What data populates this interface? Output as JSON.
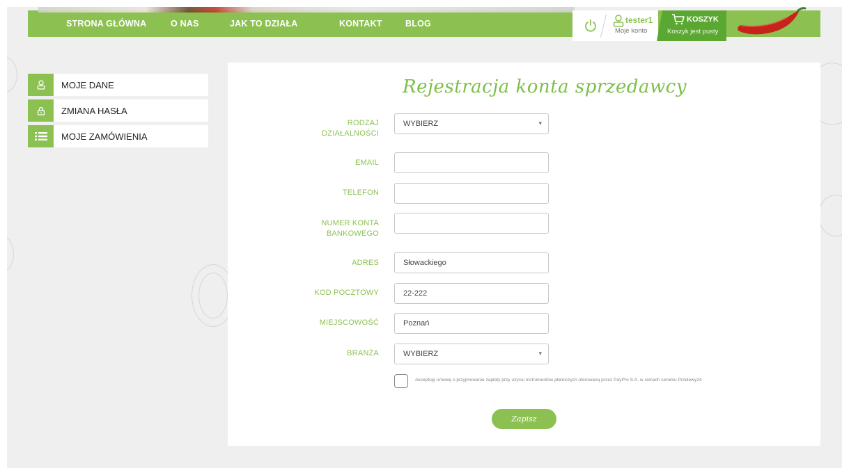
{
  "nav": {
    "links": [
      "STRONA GŁÓWNA",
      "O NAS",
      "JAK TO DZIAŁA",
      "KONTAKT",
      "BLOG"
    ]
  },
  "account": {
    "username": "tester1",
    "subtitle": "Moje konto"
  },
  "cart": {
    "title": "KOSZYK",
    "status": "Koszyk jest pusty"
  },
  "sidebar": {
    "items": [
      {
        "label": "MOJE DANE",
        "icon": "user-icon"
      },
      {
        "label": "ZMIANA HASŁA",
        "icon": "lock-icon"
      },
      {
        "label": "MOJE ZAMÓWIENIA",
        "icon": "list-icon"
      }
    ]
  },
  "form": {
    "title": "Rejestracja konta sprzedawcy",
    "fields": [
      {
        "label_line1": "RODZAJ",
        "label_line2": "DZIAŁALNOŚCI",
        "type": "select",
        "value": "WYBIERZ"
      },
      {
        "label_line1": "EMAIL",
        "label_line2": "",
        "type": "text",
        "value": ""
      },
      {
        "label_line1": "TELEFON",
        "label_line2": "",
        "type": "text",
        "value": ""
      },
      {
        "label_line1": "NUMER KONTA",
        "label_line2": "BANKOWEGO",
        "type": "text",
        "value": ""
      },
      {
        "label_line1": "ADRES",
        "label_line2": "",
        "type": "text",
        "value": "Słowackiego"
      },
      {
        "label_line1": "KOD POCZTOWY",
        "label_line2": "",
        "type": "text",
        "value": "22-222"
      },
      {
        "label_line1": "MIEJSCOWOŚĆ",
        "label_line2": "",
        "type": "text",
        "value": "Poznań"
      },
      {
        "label_line1": "BRANŻA",
        "label_line2": "",
        "type": "select",
        "value": "WYBIERZ"
      }
    ],
    "consent": "Akceptuję umowę o przyjmowanie zapłaty przy użyciu instrumentów płatniczych oferowaną przez PayPro S.A. w ramach serwisu Przelewy24",
    "consent_checked": false,
    "submit_label": "Zapisz"
  },
  "colors": {
    "accent": "#8cc152",
    "cart": "#5aa832",
    "background": "#efefef"
  }
}
